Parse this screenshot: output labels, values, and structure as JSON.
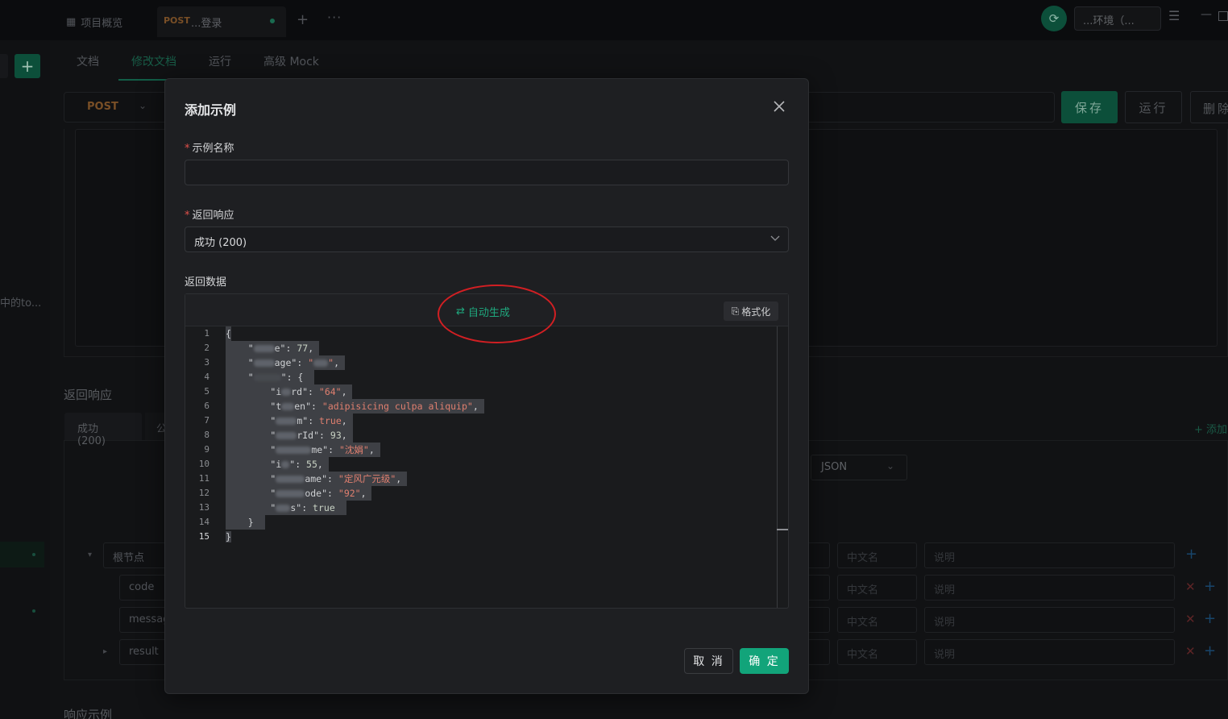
{
  "app_tabs": {
    "overview_label": "项目概览",
    "active_method": "POST",
    "active_name": "...登录",
    "plus": "+",
    "more": "···"
  },
  "header": {
    "env_label": "...环境（...",
    "menu_icon": "hamburger-icon"
  },
  "left_panel": {
    "add": "+",
    "truncated_text": "中的to..."
  },
  "sub_tabs": [
    {
      "label": "文档"
    },
    {
      "label": "修改文档"
    },
    {
      "label": "运行"
    },
    {
      "label": "高级 Mock"
    }
  ],
  "request_bar": {
    "method": "POST",
    "save_label": "保存",
    "run_label": "运行",
    "delete_label": "删除"
  },
  "response_section": {
    "title": "返回响应",
    "tab_label": "成功 (200)",
    "tab2_label": "公",
    "add_label": "+ 添加",
    "format_select": "JSON",
    "rows": [
      {
        "name": "根节点",
        "cn_placeholder": "中文名",
        "desc_placeholder": "说明"
      },
      {
        "name": "code",
        "cn_placeholder": "中文名",
        "desc_placeholder": "说明"
      },
      {
        "name": "messag",
        "cn_placeholder": "中文名",
        "desc_placeholder": "说明"
      },
      {
        "name": "result",
        "cn_placeholder": "中文名",
        "desc_placeholder": "说明"
      }
    ],
    "example_title": "响应示例"
  },
  "modal": {
    "title": "添加示例",
    "name_label": "示例名称",
    "name_value": "",
    "response_label": "返回响应",
    "response_value": "成功 (200)",
    "data_label": "返回数据",
    "auto_generate_label": "自动生成",
    "format_label": "格式化",
    "cancel_label": "取 消",
    "ok_label": "确 定",
    "code_lines": [
      {
        "n": "1"
      },
      {
        "n": "2",
        "key_end": "e\"",
        "value": "77"
      },
      {
        "n": "3",
        "key_end": "age\"",
        "value": "\""
      },
      {
        "n": "4",
        "key_end": "\"",
        "value": "{"
      },
      {
        "n": "5",
        "key_start": "\"i",
        "key_end": "rd\"",
        "value": "\"64\""
      },
      {
        "n": "6",
        "key_start": "\"t",
        "key_end": "en\"",
        "value": "\"adipisicing culpa aliquip\""
      },
      {
        "n": "7",
        "key_start": "\"",
        "key_end": "m\"",
        "value": "true"
      },
      {
        "n": "8",
        "key_start": "\"",
        "key_end": "rId\"",
        "value": "93"
      },
      {
        "n": "9",
        "key_start": "\"",
        "key_end": "me\"",
        "value": "\"沈娟\""
      },
      {
        "n": "10",
        "key_start": "\"i",
        "key_end": "\"",
        "value": "55"
      },
      {
        "n": "11",
        "key_start": "\"",
        "key_end": "ame\"",
        "value": "\"定风广元级\""
      },
      {
        "n": "12",
        "key_start": "\"",
        "key_end": "ode\"",
        "value": "\"92\""
      },
      {
        "n": "13",
        "key_start": "\"",
        "key_end": "s\"",
        "value": "true"
      },
      {
        "n": "14",
        "text": "}"
      },
      {
        "n": "15",
        "text": "}"
      }
    ]
  },
  "colors": {
    "accent": "#12a47a",
    "required_star": "#e0504a",
    "annotation_circle": "#d21f23",
    "string_value": "#e07f6f"
  }
}
